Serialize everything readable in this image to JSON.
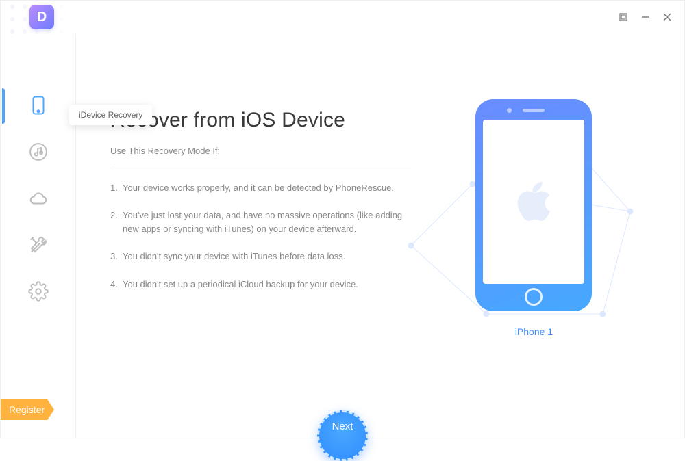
{
  "titlebar": {
    "logo_letter": "D"
  },
  "sidebar": {
    "items": [
      {
        "id": "idevice",
        "tooltip": "iDevice Recovery",
        "active": true
      },
      {
        "id": "itunes",
        "tooltip": "iTunes Recovery",
        "active": false
      },
      {
        "id": "icloud",
        "tooltip": "iCloud Recovery",
        "active": false
      },
      {
        "id": "tools",
        "tooltip": "iOS Repair Tools",
        "active": false
      },
      {
        "id": "settings",
        "tooltip": "Settings",
        "active": false
      }
    ],
    "active_tooltip": "iDevice Recovery"
  },
  "main": {
    "title": "Recover from iOS Device",
    "subhead": "Use This Recovery Mode If:",
    "conditions": [
      "Your device works properly, and it can be detected by PhoneRescue.",
      "You've just lost your data, and have no massive operations (like adding new apps or syncing with iTunes) on your device afterward.",
      "You didn't sync your device with iTunes before data loss.",
      "You didn't set up a periodical iCloud backup for your device."
    ]
  },
  "device": {
    "label": "iPhone 1"
  },
  "footer": {
    "register_label": "Register",
    "next_label": "Next"
  },
  "colors": {
    "accent": "#3b8cff",
    "sidebar_icon": "#bdbdbd",
    "register": "#ffb23e"
  }
}
